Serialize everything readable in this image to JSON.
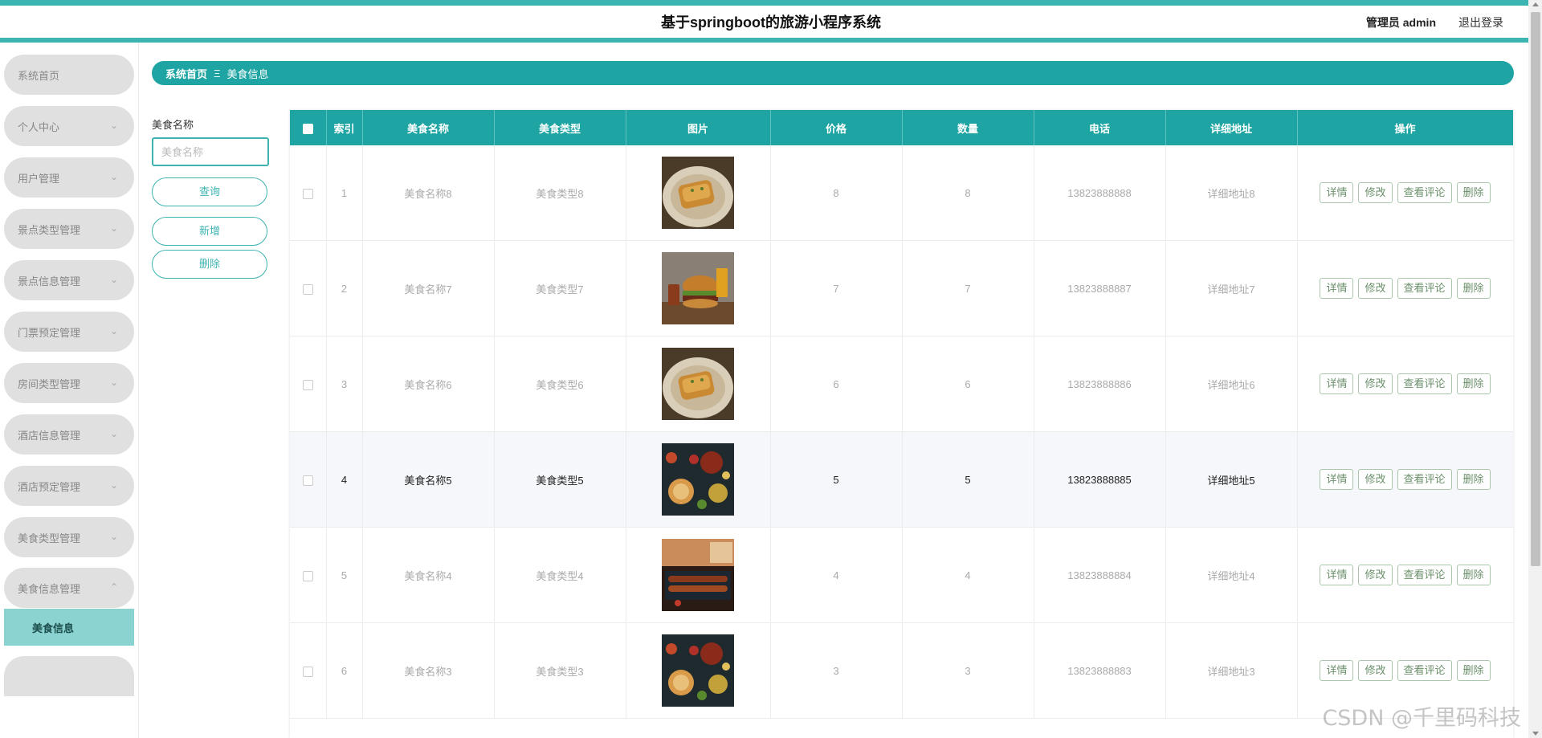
{
  "header": {
    "title": "基于springboot的旅游小程序系统",
    "user": "管理员 admin",
    "logout": "退出登录"
  },
  "sidebar": {
    "items": [
      {
        "label": "系统首页"
      },
      {
        "label": "个人中心"
      },
      {
        "label": "用户管理"
      },
      {
        "label": "景点类型管理"
      },
      {
        "label": "景点信息管理"
      },
      {
        "label": "门票预定管理"
      },
      {
        "label": "房间类型管理"
      },
      {
        "label": "酒店信息管理"
      },
      {
        "label": "酒店预定管理"
      },
      {
        "label": "美食类型管理"
      },
      {
        "label": "美食信息管理"
      }
    ],
    "sub_item": "美食信息"
  },
  "breadcrumb": {
    "home": "系统首页",
    "sep": "Ξ",
    "current": "美食信息"
  },
  "search": {
    "label": "美食名称",
    "placeholder": "美食名称",
    "query": "查询",
    "add": "新增",
    "delete": "删除"
  },
  "table": {
    "headers": [
      "索引",
      "美食名称",
      "美食类型",
      "图片",
      "价格",
      "数量",
      "电话",
      "详细地址",
      "操作"
    ],
    "actions": [
      "详情",
      "修改",
      "查看评论",
      "删除"
    ],
    "rows": [
      {
        "index": "1",
        "name": "美食名称8",
        "type": "美食类型8",
        "image": "fried-fish",
        "price": "8",
        "qty": "8",
        "phone": "13823888888",
        "addr": "详细地址8"
      },
      {
        "index": "2",
        "name": "美食名称7",
        "type": "美食类型7",
        "image": "burger",
        "price": "7",
        "qty": "7",
        "phone": "13823888887",
        "addr": "详细地址7"
      },
      {
        "index": "3",
        "name": "美食名称6",
        "type": "美食类型6",
        "image": "fried-fish",
        "price": "6",
        "qty": "6",
        "phone": "13823888886",
        "addr": "详细地址6"
      },
      {
        "index": "4",
        "name": "美食名称5",
        "type": "美食类型5",
        "image": "food-spread",
        "price": "5",
        "qty": "5",
        "phone": "13823888885",
        "addr": "详细地址5"
      },
      {
        "index": "5",
        "name": "美食名称4",
        "type": "美食类型4",
        "image": "grilled-skewers",
        "price": "4",
        "qty": "4",
        "phone": "13823888884",
        "addr": "详细地址4"
      },
      {
        "index": "6",
        "name": "美食名称3",
        "type": "美食类型3",
        "image": "food-spread",
        "price": "3",
        "qty": "3",
        "phone": "13823888883",
        "addr": "详细地址3"
      }
    ],
    "highlighted_index": "4"
  },
  "watermark": "CSDN @千里码科技",
  "colors": {
    "teal": "#1ea5a3",
    "teal_light": "#8ad3d1",
    "menu_gray": "#e0e0e0",
    "action_border": "#a9c7a9"
  }
}
